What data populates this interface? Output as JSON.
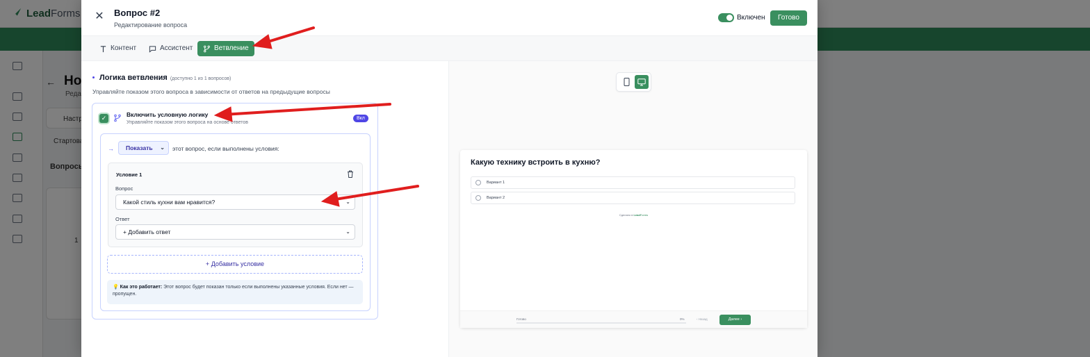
{
  "background": {
    "logo_lead": "Lead",
    "logo_forms": "Forms",
    "page_title": "Но",
    "page_subtitle": "Редак",
    "settings_tab": "Настр",
    "start_label": "Стартова",
    "questions_label": "Вопросы",
    "row_number": "1"
  },
  "modal": {
    "title": "Вопрос #2",
    "subtitle": "Редактирование вопроса",
    "enabled_label": "Включен",
    "done_button": "Готово",
    "tabs": [
      {
        "label": "Контент",
        "icon": "text-icon",
        "active": false
      },
      {
        "label": "Ассистент",
        "icon": "chat-icon",
        "active": false
      },
      {
        "label": "Ветвление",
        "icon": "branch-icon",
        "active": true
      }
    ]
  },
  "branching": {
    "section_title": "Логика ветвления",
    "section_note": "(доступно 1 из 1 вопросов)",
    "section_desc": "Управляйте показом этого вопроса в зависимости от ответов на предыдущие вопросы",
    "enable_title": "Включить условную логику",
    "enable_desc": "Управляйте показом этого вопроса на основе ответов",
    "on_badge": "Вкл",
    "action_value": "Показать",
    "action_suffix": "этот вопрос, если выполнены условия:",
    "condition": {
      "title": "Условие 1",
      "question_label": "Вопрос",
      "question_value": "Какой стиль кухни вам нравится?",
      "answer_label": "Ответ",
      "answer_value": "+ Добавить ответ"
    },
    "add_condition": "Добавить условие",
    "info_strong": "Как это работает:",
    "info_text": "Этот вопрос будет показан только если выполнены указанные условия. Если нет — пропущен."
  },
  "preview": {
    "question": "Какую технику встроить в кухню?",
    "options": [
      "Вариант 1",
      "Вариант 2"
    ],
    "made_with": "Сделано в",
    "brand_lead": "Lead",
    "brand_forms": "Forms",
    "progress_label": "Готово",
    "progress_value": 0,
    "progress_pct": "0%",
    "back_label": "Назад",
    "next_label": "Далее"
  },
  "colors": {
    "brand_green": "#3a8f5f",
    "accent_indigo": "#4f46e5",
    "annotation_red": "#e01e1e"
  }
}
